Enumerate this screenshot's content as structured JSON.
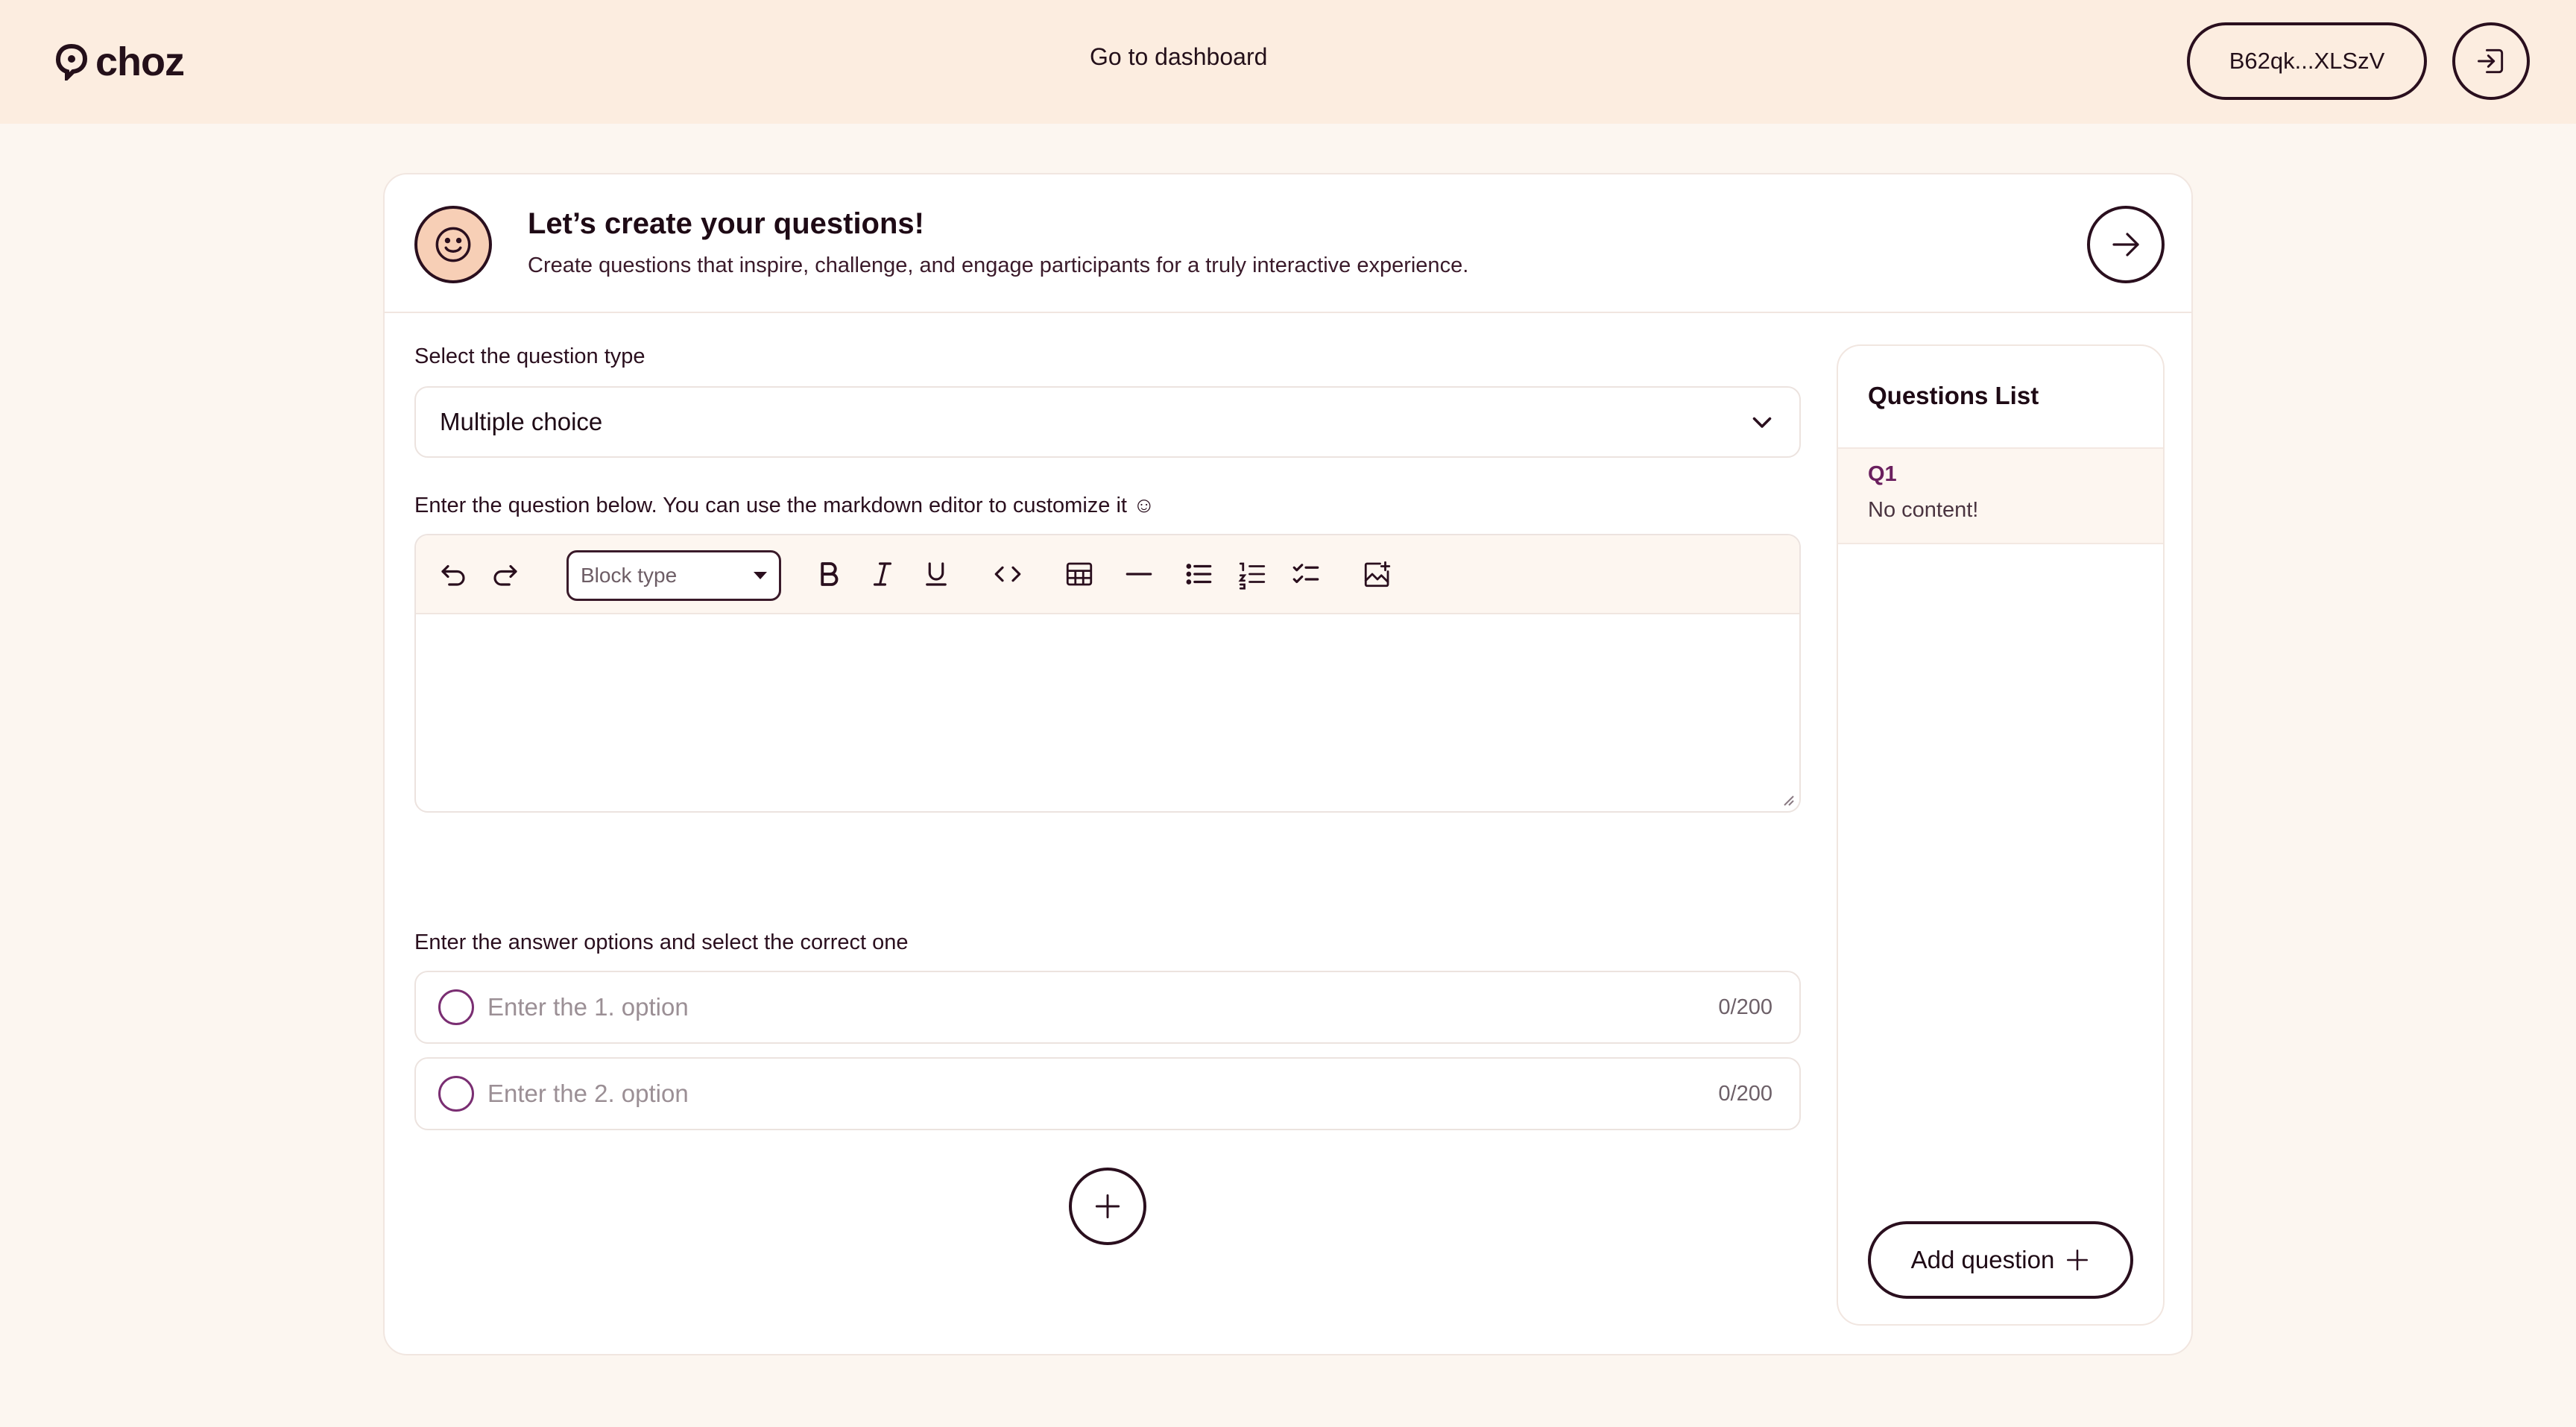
{
  "app": {
    "name": "choz"
  },
  "topbar": {
    "dashboard_link": "Go to dashboard",
    "wallet_address": "B62qk...XLSzV",
    "logout_icon": "login-arrow-icon"
  },
  "header": {
    "title": "Let’s create your questions!",
    "subtitle": "Create questions that inspire, challenge, and engage participants for a truly interactive experience.",
    "smiley_icon": "smiley-icon",
    "next_icon": "arrow-right-icon"
  },
  "question_type": {
    "label": "Select the question type",
    "value": "Multiple choice"
  },
  "editor": {
    "label": "Enter the question below. You can use the markdown editor to customize it ☺",
    "block_type_placeholder": "Block type",
    "tools": [
      "undo-icon",
      "redo-icon",
      "bold-icon",
      "italic-icon",
      "underline-icon",
      "code-icon",
      "table-icon",
      "horizontal-rule-icon",
      "bullet-list-icon",
      "numbered-list-icon",
      "checklist-icon",
      "insert-image-icon"
    ]
  },
  "answers": {
    "label": "Enter the answer options and select the correct one",
    "options": [
      {
        "placeholder": "Enter the 1. option",
        "counter": "0/200"
      },
      {
        "placeholder": "Enter the 2. option",
        "counter": "0/200"
      }
    ]
  },
  "questions_list": {
    "title": "Questions List",
    "items": [
      {
        "id": "Q1",
        "content": "No content!"
      }
    ],
    "add_button": "Add question"
  },
  "colors": {
    "topbar_bg": "#fcede0",
    "page_bg": "#fcf6f0",
    "ink": "#2a0f1e",
    "accent_purple": "#7a2e72",
    "smiley_bg": "#f7cfb6"
  }
}
